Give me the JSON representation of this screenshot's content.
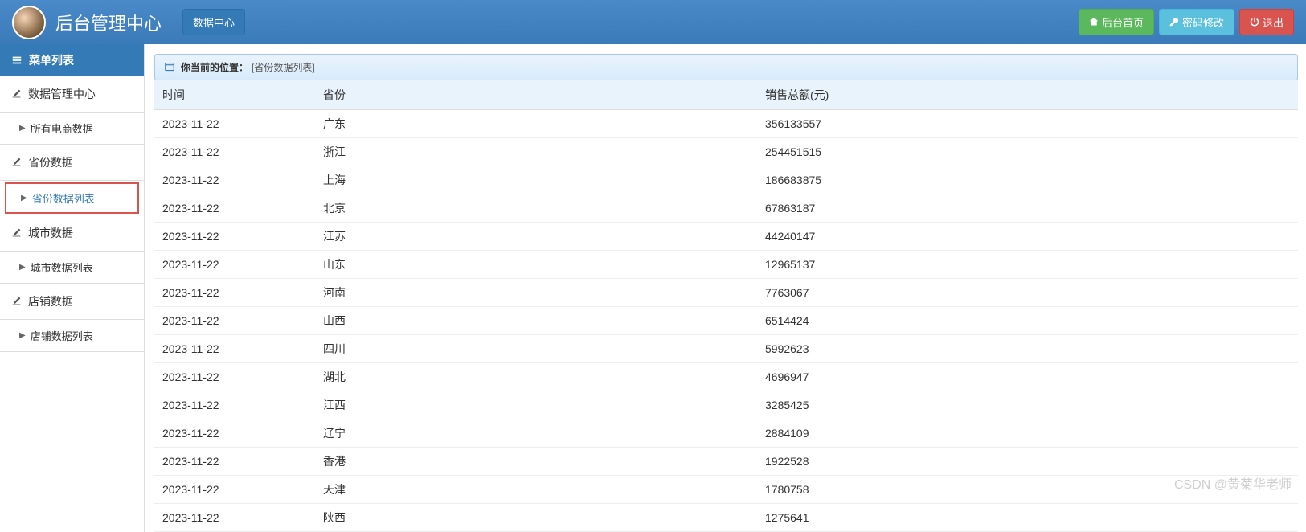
{
  "header": {
    "title": "后台管理中心",
    "nav_button": "数据中心",
    "home_button": "后台首页",
    "password_button": "密码修改",
    "logout_button": "退出"
  },
  "sidebar": {
    "header": "菜单列表",
    "groups": [
      {
        "label": "数据管理中心",
        "items": [
          {
            "label": "所有电商数据",
            "active": false,
            "highlight": false
          }
        ]
      },
      {
        "label": "省份数据",
        "items": [
          {
            "label": "省份数据列表",
            "active": true,
            "highlight": true
          }
        ]
      },
      {
        "label": "城市数据",
        "items": [
          {
            "label": "城市数据列表",
            "active": false,
            "highlight": false
          }
        ]
      },
      {
        "label": "店铺数据",
        "items": [
          {
            "label": "店铺数据列表",
            "active": false,
            "highlight": false
          }
        ]
      }
    ]
  },
  "breadcrumb": {
    "label": "你当前的位置：",
    "value": "[省份数据列表]"
  },
  "table": {
    "columns": [
      "时间",
      "省份",
      "销售总额(元)"
    ],
    "rows": [
      {
        "date": "2023-11-22",
        "province": "广东",
        "amount": "356133557"
      },
      {
        "date": "2023-11-22",
        "province": "浙江",
        "amount": "254451515"
      },
      {
        "date": "2023-11-22",
        "province": "上海",
        "amount": "186683875"
      },
      {
        "date": "2023-11-22",
        "province": "北京",
        "amount": "67863187"
      },
      {
        "date": "2023-11-22",
        "province": "江苏",
        "amount": "44240147"
      },
      {
        "date": "2023-11-22",
        "province": "山东",
        "amount": "12965137"
      },
      {
        "date": "2023-11-22",
        "province": "河南",
        "amount": "7763067"
      },
      {
        "date": "2023-11-22",
        "province": "山西",
        "amount": "6514424"
      },
      {
        "date": "2023-11-22",
        "province": "四川",
        "amount": "5992623"
      },
      {
        "date": "2023-11-22",
        "province": "湖北",
        "amount": "4696947"
      },
      {
        "date": "2023-11-22",
        "province": "江西",
        "amount": "3285425"
      },
      {
        "date": "2023-11-22",
        "province": "辽宁",
        "amount": "2884109"
      },
      {
        "date": "2023-11-22",
        "province": "香港",
        "amount": "1922528"
      },
      {
        "date": "2023-11-22",
        "province": "天津",
        "amount": "1780758"
      },
      {
        "date": "2023-11-22",
        "province": "陕西",
        "amount": "1275641"
      }
    ]
  },
  "watermark": "CSDN @黄菊华老师"
}
